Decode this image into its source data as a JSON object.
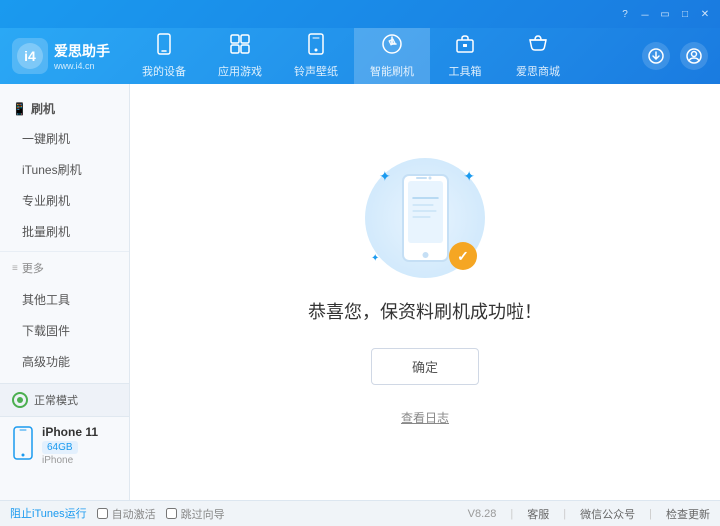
{
  "titlebar": {
    "controls": [
      "minimize",
      "maximize",
      "restore",
      "close"
    ]
  },
  "header": {
    "logo": {
      "icon": "爱",
      "title": "爱思助手",
      "subtitle": "www.i4.cn"
    },
    "nav_tabs": [
      {
        "id": "my-device",
        "icon": "📱",
        "label": "我的设备"
      },
      {
        "id": "apps-games",
        "icon": "🎮",
        "label": "应用游戏"
      },
      {
        "id": "ringtones",
        "icon": "🔔",
        "label": "铃声壁纸"
      },
      {
        "id": "smart-flash",
        "icon": "🛡",
        "label": "智能刷机",
        "active": true
      },
      {
        "id": "tools",
        "icon": "🧰",
        "label": "工具箱"
      },
      {
        "id": "store",
        "icon": "🛍",
        "label": "爱思商城"
      }
    ],
    "right_buttons": [
      "download",
      "user"
    ]
  },
  "sidebar": {
    "section_flash": "刷机",
    "items_flash": [
      {
        "id": "one-click-flash",
        "label": "一键刷机"
      },
      {
        "id": "itunes-flash",
        "label": "iTunes刷机"
      },
      {
        "id": "pro-flash",
        "label": "专业刷机"
      },
      {
        "id": "batch-flash",
        "label": "批量刷机"
      }
    ],
    "section_more": "更多",
    "items_more": [
      {
        "id": "other-tools",
        "label": "其他工具"
      },
      {
        "id": "download-firmware",
        "label": "下载固件"
      },
      {
        "id": "advanced",
        "label": "高级功能"
      }
    ],
    "device": {
      "mode_label": "正常模式",
      "name": "iPhone 11",
      "storage": "64GB",
      "type": "iPhone"
    }
  },
  "content": {
    "success_message": "恭喜您，保资料刷机成功啦！",
    "confirm_button": "确定",
    "check_log_link": "查看日志"
  },
  "footer": {
    "version": "V8.28",
    "auto_activate_label": "自动激活",
    "skip_guide_label": "跳过向导",
    "support_label": "客服",
    "wechat_label": "微信公众号",
    "check_update_label": "检查更新",
    "stop_itunes_label": "阻止iTunes运行"
  }
}
